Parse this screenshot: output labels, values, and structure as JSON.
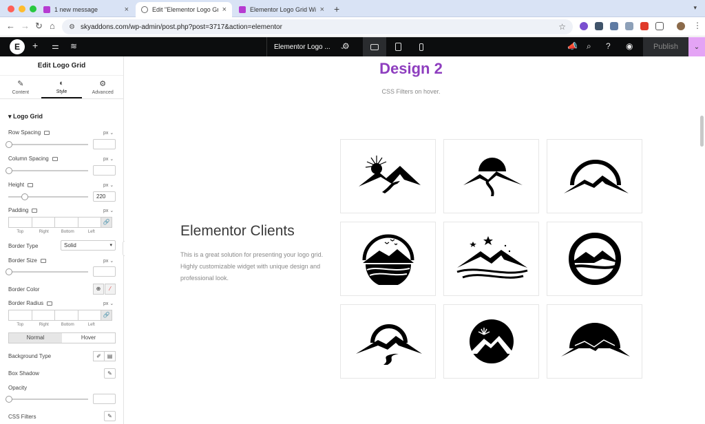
{
  "browser": {
    "tabs": [
      {
        "title": "1 new message",
        "favicon_color": "#b63bd1",
        "active": false
      },
      {
        "title": "Edit \"Elementor Logo Grid W",
        "favicon_color": "#666666",
        "active": true
      },
      {
        "title": "Elementor Logo Grid Widget",
        "favicon_color": "#b63bd1",
        "active": false
      }
    ],
    "url": "skyaddons.com/wp-admin/post.php?post=3717&action=elementor",
    "new_tab": "+",
    "close_glyph": "×"
  },
  "editor": {
    "document_title": "Elementor Logo ...",
    "publish_label": "Publish",
    "active_device": "desktop"
  },
  "panel": {
    "title": "Edit Logo Grid",
    "tabs": [
      {
        "label": "Content",
        "icon": "pencil-icon"
      },
      {
        "label": "Style",
        "icon": "contrast-icon",
        "active": true
      },
      {
        "label": "Advanced",
        "icon": "gear-icon"
      }
    ],
    "section": "Logo Grid",
    "unit": "px",
    "row_spacing": {
      "label": "Row Spacing",
      "value": ""
    },
    "column_spacing": {
      "label": "Column Spacing",
      "value": ""
    },
    "height": {
      "label": "Height",
      "value": "220"
    },
    "padding": {
      "label": "Padding"
    },
    "dim_labels": [
      "Top",
      "Right",
      "Bottom",
      "Left"
    ],
    "border_type": {
      "label": "Border Type",
      "value": "Solid"
    },
    "border_size": {
      "label": "Border Size",
      "value": ""
    },
    "border_color": {
      "label": "Border Color"
    },
    "border_radius": {
      "label": "Border Radius"
    },
    "state_tabs": [
      "Normal",
      "Hover"
    ],
    "background_type": {
      "label": "Background Type"
    },
    "box_shadow": {
      "label": "Box Shadow"
    },
    "opacity": {
      "label": "Opacity",
      "value": ""
    },
    "css_filters": {
      "label": "CSS Filters"
    }
  },
  "canvas": {
    "heading": "Design 2",
    "subheading": "CSS Filters on hover.",
    "clients_title": "Elementor Clients",
    "clients_description": "This is a great solution for presenting your logo grid. Highly customizable widget with unique design and professional look.",
    "logos": [
      "mountain-sunburst-logo",
      "mountain-sun-road-logo",
      "mountain-arc-logo",
      "mountain-birds-circle-logo",
      "mountain-stars-waves-logo",
      "mountain-ring-logo",
      "mountain-arc-road-logo",
      "mountain-sunrise-disc-logo",
      "mountain-black-sun-logo"
    ]
  },
  "colors": {
    "accent_purple": "#8e3ebf",
    "publish_more": "#e4a4f5",
    "editor_bar": "#0c0d0e"
  }
}
